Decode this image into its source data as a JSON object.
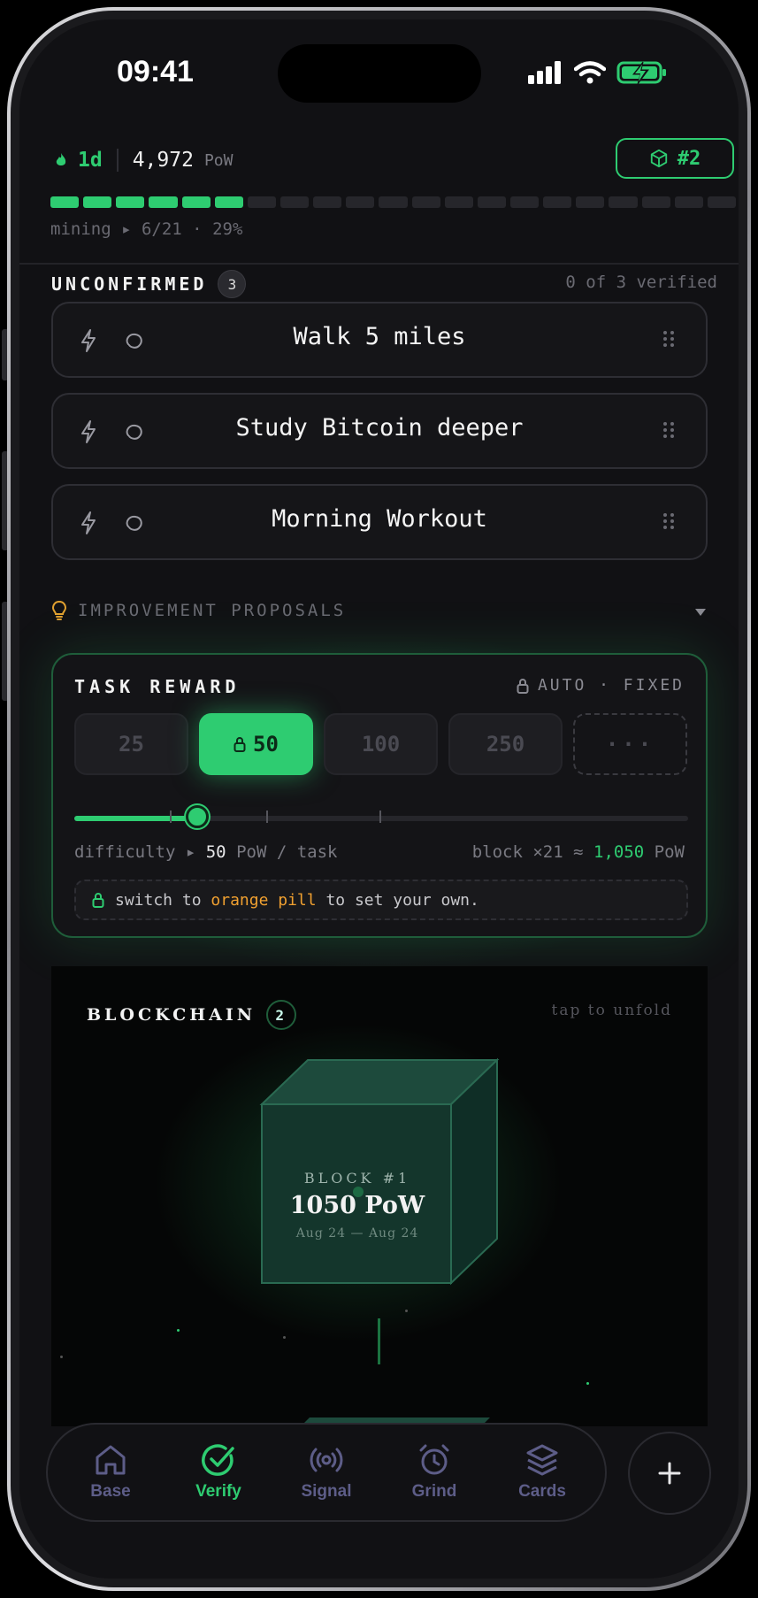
{
  "status_bar": {
    "time": "09:41"
  },
  "header": {
    "streak": "1d",
    "pow_amount": "4,972",
    "pow_unit": "PoW",
    "block_badge": "#2",
    "mining_label": "mining",
    "mining_progress": "6/21",
    "mining_percent": "29%",
    "segments_filled": 6,
    "segments_total": 21
  },
  "unconfirmed": {
    "title": "UNCONFIRMED",
    "count": "3",
    "verified_text": "0 of 3 verified",
    "tasks": [
      {
        "label": "Walk 5 miles"
      },
      {
        "label": "Study Bitcoin deeper"
      },
      {
        "label": "Morning Workout"
      }
    ]
  },
  "proposals": {
    "label": "IMPROVEMENT PROPOSALS"
  },
  "reward": {
    "title": "TASK REWARD",
    "mode": "AUTO · FIXED",
    "options": [
      "25",
      "50",
      "100",
      "250",
      "···"
    ],
    "selected": "50",
    "slider_value_fraction": 0.2,
    "difficulty_label": "difficulty",
    "difficulty_value": "50",
    "difficulty_unit": "PoW / task",
    "block_label": "block ×21 ≈",
    "block_value": "1,050",
    "block_unit": "PoW",
    "hint_prefix": "switch to",
    "hint_highlight": "orange pill",
    "hint_suffix": "to set your own."
  },
  "blockchain": {
    "title": "BLOCKCHAIN",
    "count": "2",
    "tap_hint": "tap to unfold",
    "block_title": "BLOCK #1",
    "block_pow": "1050 PoW",
    "block_dates": "Aug 24 — Aug 24"
  },
  "nav": {
    "items": [
      {
        "label": "Base",
        "icon": "home-icon"
      },
      {
        "label": "Verify",
        "icon": "check-circle-icon"
      },
      {
        "label": "Signal",
        "icon": "broadcast-icon"
      },
      {
        "label": "Grind",
        "icon": "alarm-clock-icon"
      },
      {
        "label": "Cards",
        "icon": "layers-icon"
      }
    ],
    "active": "Verify"
  },
  "colors": {
    "accent": "#2ecc71",
    "orange": "#f0a030",
    "background": "#111114"
  }
}
